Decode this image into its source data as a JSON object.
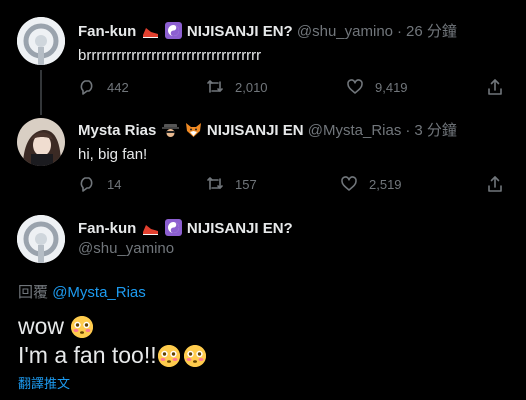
{
  "tweets": [
    {
      "name": "Fan-kun",
      "suffix": "NIJISANJI EN?",
      "handle": "@shu_yamino",
      "time": "26 分鐘",
      "text": "brrrrrrrrrrrrrrrrrrrrrrrrrrrrrrrrrrr",
      "replies": "442",
      "retweets": "2,010",
      "likes": "9,419"
    },
    {
      "name": "Mysta Rias",
      "suffix": "NIJISANJI EN",
      "handle": "@Mysta_Rias",
      "time": "3 分鐘",
      "text": "hi, big fan!",
      "replies": "14",
      "retweets": "157",
      "likes": "2,519"
    }
  ],
  "main": {
    "name": "Fan-kun",
    "suffix": "NIJISANJI EN?",
    "handle": "@shu_yamino",
    "reply_prefix": "回覆",
    "reply_mention": "@Mysta_Rias",
    "line1": "wow",
    "line2": "I'm a fan too!!",
    "translate": "翻譯推文"
  },
  "icons": {
    "reply": "reply-icon",
    "retweet": "retweet-icon",
    "like": "heart-icon",
    "share": "share-icon"
  },
  "colors": {
    "background": "#000000",
    "text": "#e7e9ea",
    "muted": "#71767b",
    "link": "#1d9bf0"
  }
}
